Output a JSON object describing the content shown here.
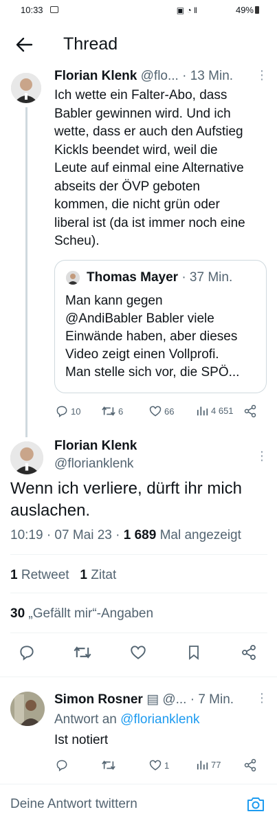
{
  "status_bar": {
    "time": "10:33",
    "battery": "49%"
  },
  "header": {
    "title": "Thread"
  },
  "tweet1": {
    "name": "Florian Klenk",
    "handle": "@flo...",
    "time": "· 13 Min.",
    "text": [
      "Ich wette ein Falter-Abo, dass",
      "Babler gewinnen wird. Und ich",
      "wette, dass er auch den Aufstieg",
      "Kickls beendet wird, weil die",
      "Leute auf einmal eine Alternative",
      "abseits der ÖVP geboten",
      "kommen, die nicht grün oder",
      "liberal ist (da ist immer noch eine",
      "Scheu)."
    ],
    "quote": {
      "name": "Thomas Mayer",
      "time": "· 37 Min.",
      "text": [
        "Man kann gegen",
        "@AndiBabler Babler viele",
        "Einwände haben, aber dieses",
        "Video zeigt einen Vollprofi.",
        "Man stelle sich vor, die SPÖ..."
      ]
    },
    "actions": {
      "replies": "10",
      "retweets": "6",
      "likes": "66",
      "views": "4 651"
    }
  },
  "main_tweet": {
    "name": "Florian Klenk",
    "handle": "@florianklenk",
    "text": [
      "Wenn ich verliere, dürft ihr mich",
      "auslachen."
    ],
    "timestamp": "10:19 · 07 Mai 23 ·",
    "views_count": "1 689",
    "views_label": "Mal angezeigt",
    "retweets_count": "1",
    "retweets_label": "Retweet",
    "quotes_count": "1",
    "quotes_label": "Zitat",
    "likes_count": "30",
    "likes_label": "„Gefällt mir“-Angaben"
  },
  "reply": {
    "name": "Simon Rosner",
    "handle": "@...",
    "time": "· 7 Min.",
    "reply_to_prefix": "Antwort an",
    "reply_to_handle": "@florianklenk",
    "text": "Ist notiert",
    "actions": {
      "likes": "1",
      "views": "77"
    }
  },
  "composer": {
    "placeholder": "Deine Antwort twittern"
  },
  "colors": {
    "accent": "#1d9bf0",
    "muted": "#536471",
    "border": "#cfd9de"
  }
}
